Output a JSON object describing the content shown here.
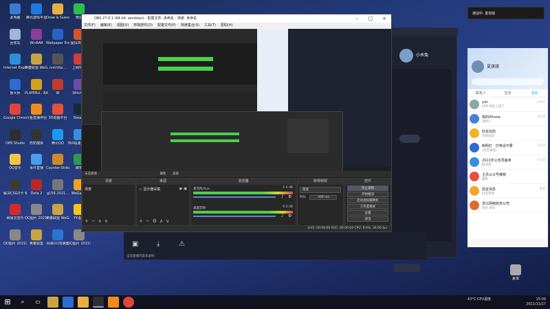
{
  "notification": {
    "text": "通话中: 夏琪琪"
  },
  "desktop_icons": [
    {
      "label": "此电脑",
      "color": "#3a7bd5"
    },
    {
      "label": "腾讯游戏平台",
      "color": "#1d7be0"
    },
    {
      "label": "Draw & Guess",
      "color": "#e8b041"
    },
    {
      "label": "微信",
      "color": "#2bbf4b"
    },
    {
      "label": "回收站",
      "color": "#9fb6d6"
    },
    {
      "label": "WinRAR",
      "color": "#8a3f9e"
    },
    {
      "label": "Wallpaper Engine",
      "color": "#2a62c6"
    },
    {
      "label": "猛犸浏览器",
      "color": "#d9532b"
    },
    {
      "label": "Internet Explorer",
      "color": "#2d8fd9"
    },
    {
      "label": "英雄联盟 WeGame版",
      "color": "#c8a445"
    },
    {
      "label": "rsrchttp...",
      "color": "#555"
    },
    {
      "label": "上网导航",
      "color": "#d43c3c"
    },
    {
      "label": "鲁大师",
      "color": "#2f6bd1"
    },
    {
      "label": "PLAYERU.. BATTLEGR..",
      "color": "#d4a01e"
    },
    {
      "label": "W",
      "color": "#c23a2f"
    },
    {
      "label": "Witch It",
      "color": "#6b4aa8"
    },
    {
      "label": "Google Chrome",
      "color": "#e2453a"
    },
    {
      "label": "斗鱼直播伴侣",
      "color": "#f28b1e"
    },
    {
      "label": "3D动画平台",
      "color": "#e84e3a"
    },
    {
      "label": "Steam",
      "color": "#1b2838"
    },
    {
      "label": "OBS Studio",
      "color": "#302e31"
    },
    {
      "label": "奶奶模拟",
      "color": "#333"
    },
    {
      "label": "腾讯QQ",
      "color": "#1b9af2"
    },
    {
      "label": "360极速浏览器",
      "color": "#3a8de0"
    },
    {
      "label": "QQ音乐",
      "color": "#f4c542"
    },
    {
      "label": "事件直播",
      "color": "#4a9de8"
    },
    {
      "label": "Counter-Strike Global Off...",
      "color": "#cf8a28"
    },
    {
      "label": "麻将",
      "color": "#2e9a4f"
    },
    {
      "label": "解决CSGO卡 顿问题",
      "color": "#3b3b3b"
    },
    {
      "label": "Dota 2",
      "color": "#b82a25"
    },
    {
      "label": "g156-2021...",
      "color": "#777"
    },
    {
      "label": "WeGame",
      "color": "#f1a31e"
    },
    {
      "label": "网易云音乐",
      "color": "#d12b2b"
    },
    {
      "label": "QQ图片 20210621...",
      "color": "#888"
    },
    {
      "label": "英雄联盟 WeGame版",
      "color": "#c8a445"
    },
    {
      "label": "YY语音",
      "color": "#f5c518"
    },
    {
      "label": "QQ图片 20210621...",
      "color": "#888"
    },
    {
      "label": "英雄联盟",
      "color": "#c8a445"
    },
    {
      "label": "网易UU加速器",
      "color": "#2a76d2"
    },
    {
      "label": "QQ图片 20210928...",
      "color": "#888"
    },
    {
      "label": "夏琪",
      "color": "#aaa"
    }
  ],
  "obs": {
    "title": "OBS 27.0.1 (64 bit, windows) - 配置文件: 未命名 - 场景: 未命名",
    "menu": [
      "文件(F)",
      "编辑(E)",
      "视图(V)",
      "停靠部件(D)",
      "配置文件(P)",
      "场景集合(S)",
      "工具(T)",
      "帮助(H)"
    ],
    "scenes_header": "场景",
    "scenes": [
      "场景"
    ],
    "sources_header": "来源",
    "sources": [
      "显示器采集"
    ],
    "mixer_header": "混音器",
    "mixer": [
      {
        "name": "麦克风/Aux",
        "db": "-1.4 dB"
      },
      {
        "name": "桌面音频",
        "db": "-0.0 dB"
      }
    ],
    "transitions_header": "转场特效",
    "transition_value": "渐变",
    "duration_label": "时长",
    "duration_value": "300 ms",
    "controls_header": "控件",
    "controls": [
      "停止录制",
      "开始推流",
      "启动虚拟摄像机",
      "工作室模式",
      "设置",
      "退出"
    ],
    "status": "LIVE: 00:00:00   REC: 00:00:04   CPU: 8.9%, 30.00 fps",
    "no_source": "未选择源",
    "properties": "属性",
    "filters": "滤镜"
  },
  "qq_live": {
    "title": "小木兔",
    "bottom_tip": "当前直播内容未录制"
  },
  "chat_app": {
    "user": "夏琪琪",
    "tabs": [
      "联系人",
      "空间",
      "消息"
    ],
    "items": [
      {
        "name": "yan",
        "msg": "好的 明天上线了",
        "time": "15:07",
        "color": "#8aa"
      },
      {
        "name": "我的iPhone",
        "msg": "[图片]",
        "time": "14:56",
        "color": "#4a7fd8"
      },
      {
        "name": "好友动态",
        "msg": "有新动态",
        "time": "",
        "color": "#f0b32a"
      },
      {
        "name": "制明灯 · 打电话不要",
        "msg": "[语音通话]",
        "time": "13:23",
        "color": "#2f6bd1"
      },
      {
        "name": "2022年公务员备考",
        "msg": "群消息",
        "time": "11:12",
        "color": "#3c8be0"
      },
      {
        "name": "主页公众号推荐",
        "msg": "推荐",
        "time": "",
        "color": "#e84e3a"
      },
      {
        "name": "验证消息",
        "msg": "好友申请",
        "time": "昨天",
        "color": "#f4a52b"
      },
      {
        "name": "浙江网络财务公司",
        "msg": "您好 请问",
        "time": "",
        "color": "#e26b2a"
      }
    ]
  },
  "taskbar": {
    "time": "15:09",
    "date": "2021/11/27",
    "weather": "43°C CPU温度"
  },
  "colors": {
    "desktop": "#233a7a",
    "obs_bg": "#2b2b2b",
    "meter_green": "#4bd04b",
    "meter_yellow": "#d8d830",
    "chat_accent": "#12b7f5"
  }
}
